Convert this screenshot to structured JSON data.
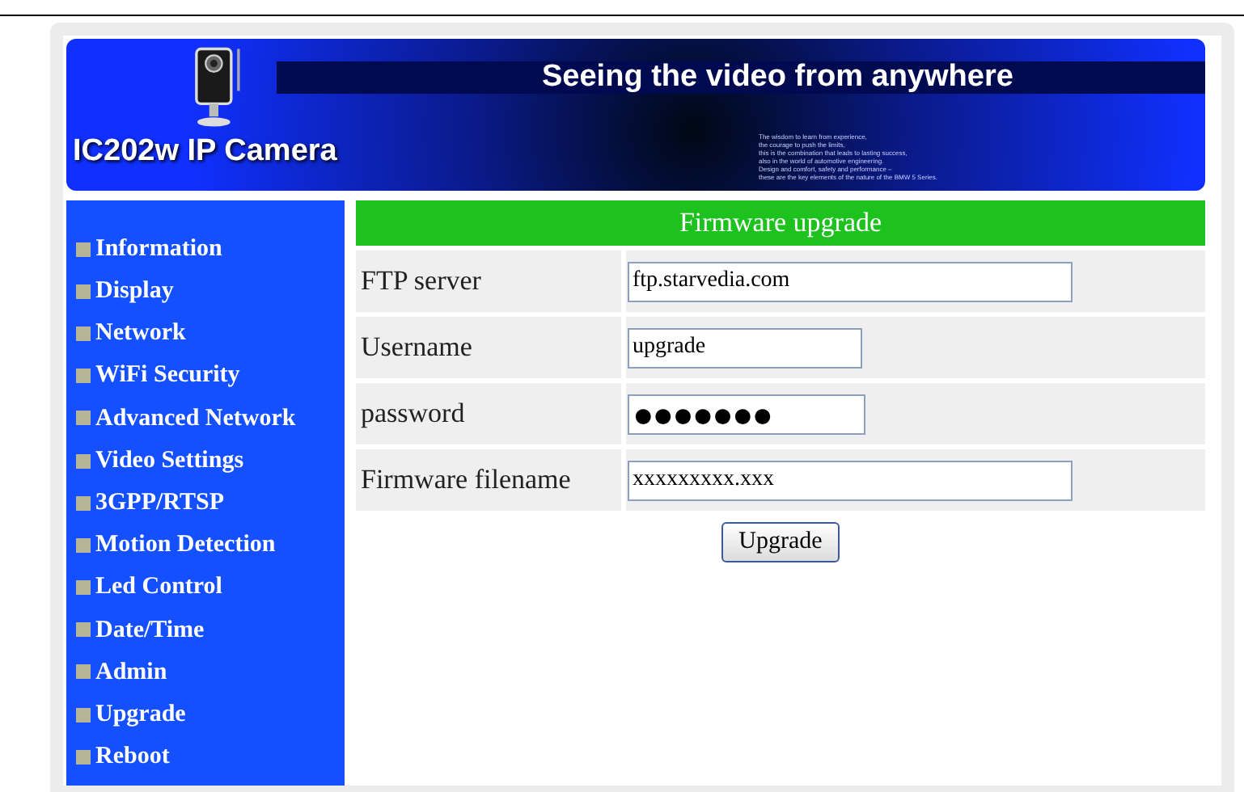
{
  "banner": {
    "headline": "Seeing the video from anywhere",
    "product": "IC202w IP Camera",
    "tagline": [
      "The wisdom to learn from experience,",
      "the courage to push the limits,",
      "this is the combination that leads to lasting success,",
      "also in the world of automotive engineering.",
      "Design and comfort, safety and performance –",
      "these are the key elements of the nature of the BMW 5 Series."
    ]
  },
  "sidebar": {
    "items": [
      {
        "label": "Information"
      },
      {
        "label": "Display"
      },
      {
        "label": "Network"
      },
      {
        "label": "WiFi Security"
      },
      {
        "label": "Advanced Network"
      },
      {
        "label": "Video Settings"
      },
      {
        "label": "3GPP/RTSP"
      },
      {
        "label": "Motion Detection"
      },
      {
        "label": "Led Control"
      },
      {
        "label": "Date/Time"
      },
      {
        "label": "Admin"
      },
      {
        "label": "Upgrade"
      },
      {
        "label": "Reboot"
      }
    ]
  },
  "form": {
    "title": "Firmware upgrade",
    "fields": [
      {
        "label": "FTP server",
        "value": "ftp.starvedia.com",
        "kind": "wide"
      },
      {
        "label": "Username",
        "value": "upgrade",
        "kind": "short"
      },
      {
        "label": "password",
        "value": "●●●●●●●",
        "kind": "secret"
      },
      {
        "label": "Firmware filename",
        "value": "xxxxxxxxx.xxx",
        "kind": "wide"
      }
    ],
    "button": "Upgrade"
  }
}
